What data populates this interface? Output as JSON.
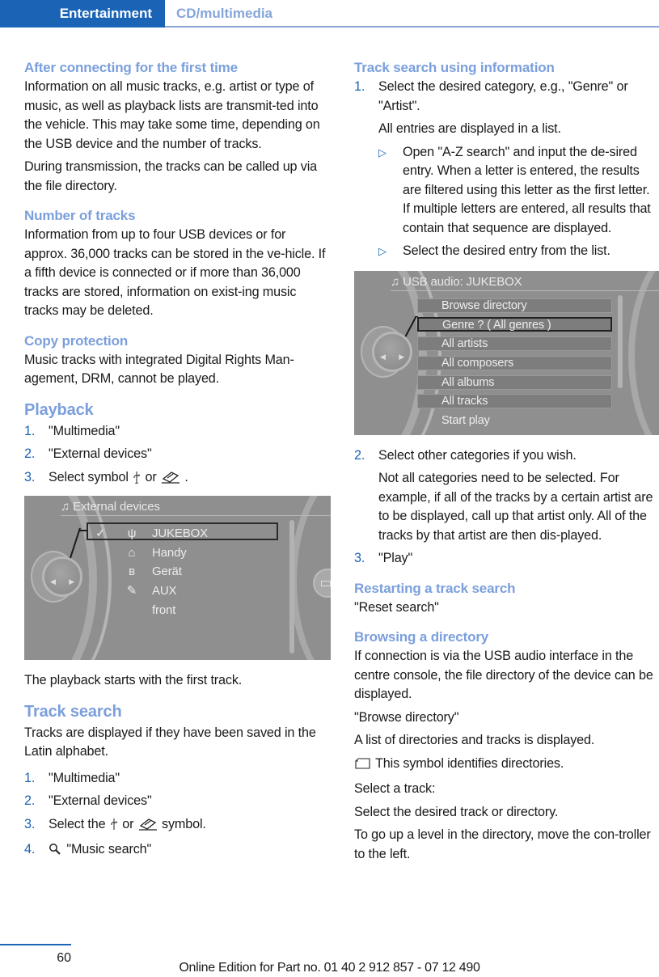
{
  "header": {
    "section": "Entertainment",
    "subsection": "CD/multimedia"
  },
  "left": {
    "after_connecting": {
      "heading": "After connecting for the first time",
      "p1": "Information on all music tracks, e.g. artist or type of music, as well as playback lists are transmit-ted into the vehicle. This may take some time, depending on the USB device and the number of tracks.",
      "p2": "During transmission, the tracks can be called up via the file directory."
    },
    "number_of_tracks": {
      "heading": "Number of tracks",
      "p1": "Information from up to four USB devices or for approx. 36,000 tracks can be stored in the ve-hicle. If a fifth device is connected or if more than 36,000 tracks are stored, information on exist-ing music tracks may be deleted."
    },
    "copy_protection": {
      "heading": "Copy protection",
      "p1": "Music tracks with integrated Digital Rights Man-agement, DRM, cannot be played."
    },
    "playback": {
      "heading": "Playback",
      "steps": [
        {
          "num": "1.",
          "text": "\"Multimedia\""
        },
        {
          "num": "2.",
          "text": "\"External devices\""
        },
        {
          "num": "3.",
          "pre": "Select symbol",
          "mid": "or",
          "post": "."
        }
      ],
      "screen": {
        "title": "External devices",
        "items": [
          {
            "check": "✓",
            "icon": "usb-icon",
            "label": "JUKEBOX",
            "selected": true
          },
          {
            "check": "",
            "icon": "mobile-phone-icon",
            "label": "Handy",
            "selected": false
          },
          {
            "check": "",
            "icon": "bluetooth-icon",
            "label": "Gerät",
            "selected": false
          },
          {
            "check": "",
            "icon": "aux-plug-icon",
            "label": "AUX front",
            "selected": false
          }
        ]
      },
      "after": "The playback starts with the first track."
    },
    "track_search": {
      "heading": "Track search",
      "p1": "Tracks are displayed if they have been saved in the Latin alphabet.",
      "steps": [
        {
          "num": "1.",
          "text": "\"Multimedia\""
        },
        {
          "num": "2.",
          "text": "\"External devices\""
        },
        {
          "num": "3.",
          "pre": "Select the",
          "mid": "or",
          "post": "symbol."
        },
        {
          "num": "4.",
          "text": "\"Music search\""
        }
      ]
    }
  },
  "right": {
    "track_search_info": {
      "heading": "Track search using information",
      "step1": {
        "num": "1.",
        "text": "Select the desired category, e.g., \"Genre\" or \"Artist\"."
      },
      "step1_note": "All entries are displayed in a list.",
      "bullets": [
        "Open \"A-Z search\" and input the de-sired entry. When a letter is entered, the results are filtered using this letter as the first letter. If multiple letters are entered, all results that contain that sequence are displayed.",
        "Select the desired entry from the list."
      ],
      "screen": {
        "title": "USB audio: JUKEBOX",
        "items": [
          {
            "label": "Browse directory",
            "selected": false
          },
          {
            "label": "Genre ? ( All genres )",
            "selected": true
          },
          {
            "label": "All artists",
            "selected": false
          },
          {
            "label": "All composers",
            "selected": false
          },
          {
            "label": "All albums",
            "selected": false
          },
          {
            "label": "All tracks",
            "selected": false
          },
          {
            "label": "Start play",
            "selected": false
          }
        ]
      },
      "step2": {
        "num": "2.",
        "text": "Select other categories if you wish."
      },
      "step2_note": "Not all categories need to be selected. For example, if all of the tracks by a certain artist are to be displayed, call up that artist only. All of the tracks by that artist are then dis-played.",
      "step3": {
        "num": "3.",
        "text": "\"Play\""
      }
    },
    "restart": {
      "heading": "Restarting a track search",
      "p1": "\"Reset search\""
    },
    "browse": {
      "heading": "Browsing a directory",
      "p1": "If connection is via the USB audio interface in the centre console, the file directory of the device can be displayed.",
      "p2": "\"Browse directory\"",
      "p3": "A list of directories and tracks is displayed.",
      "p4": "This symbol identifies directories.",
      "p5": "Select a track:",
      "p6": "Select the desired track or directory.",
      "p7": "To go up a level in the directory, move the con-troller to the left."
    }
  },
  "footer": {
    "page_number": "60",
    "edition": "Online Edition for Part no. 01 40 2 912 857 - 07 12 490"
  },
  "colors": {
    "brand_blue": "#1b63b5",
    "heading_blue": "#7a9fdc",
    "screen_gray": "#8f8f8f"
  }
}
